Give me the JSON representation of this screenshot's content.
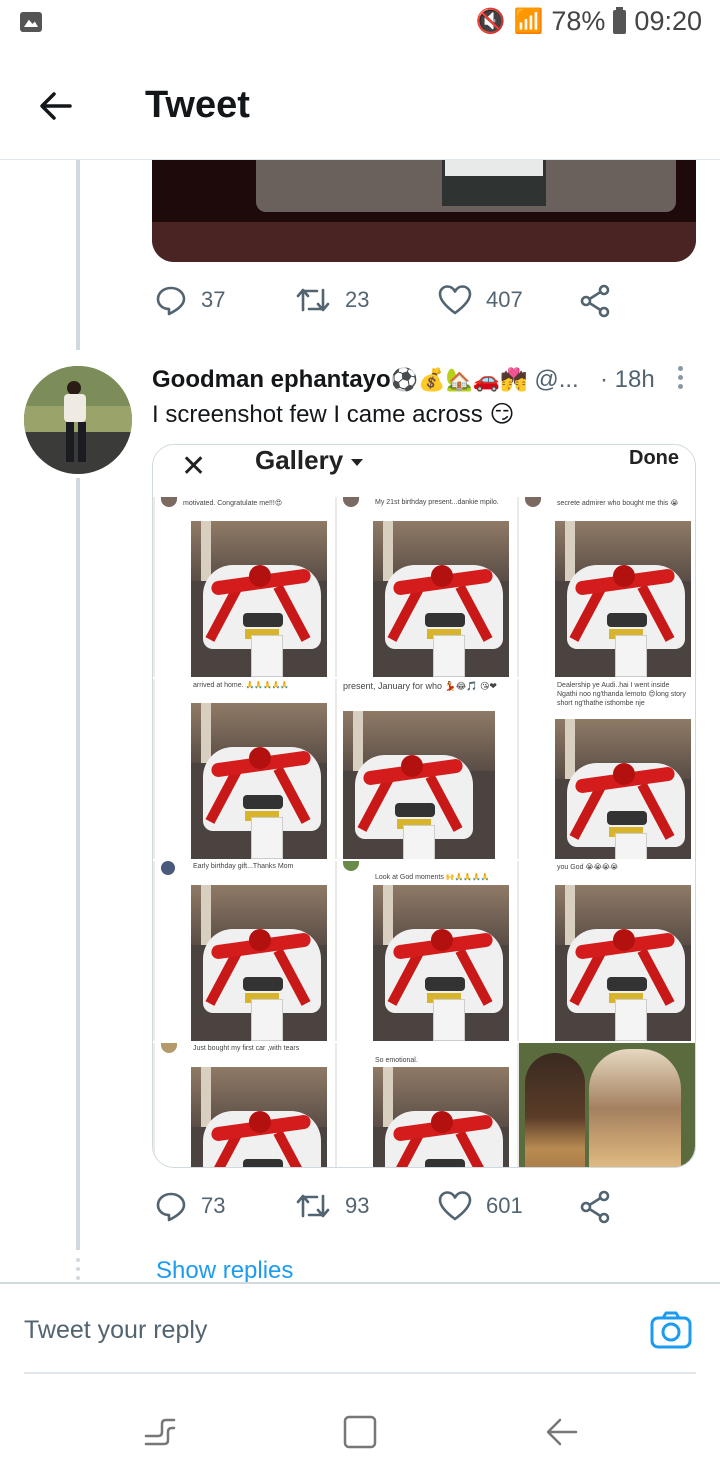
{
  "status_bar": {
    "battery_percent": "78%",
    "time": "09:20"
  },
  "header": {
    "title": "Tweet"
  },
  "previous_tweet": {
    "reply_count": "37",
    "retweet_count": "23",
    "like_count": "407"
  },
  "tweet": {
    "author_name": "Goodman ephantayo",
    "author_emoji": "⚽💰🏡🚗💏",
    "author_handle": "@...",
    "time": "· 18h",
    "text": "I screenshot few I came across 😏",
    "media": {
      "gallery_close": "✕",
      "gallery_title": "Gallery",
      "gallery_done": "Done",
      "captions": [
        "motivated. Congratulate me!!!😍",
        "My 21st birthday present...dankie mpilo.",
        "secrete admirer who bought me this 😭",
        "arrived at home. 🙏🙏🙏🙏🙏",
        "present, January for who 💃😂🎵 😘❤",
        "Dealership ye Audi..hai I went inside Ngathi noo ng'thanda lemoto 😍long story short ng'thathe isthombe nje",
        "Early birthday gift...Thanks Mom",
        "Look at God moments 🙌🙏🙏🙏🙏",
        "you God 😭😭😭😭",
        "Just bought my first car ,with tears",
        "So emotional."
      ]
    },
    "reply_count": "73",
    "retweet_count": "93",
    "like_count": "601"
  },
  "show_replies": "Show replies",
  "reply_bar": {
    "placeholder": "Tweet your reply"
  },
  "colors": {
    "accent": "#1d9bf0",
    "secondary_text": "#536471",
    "border": "#cfd9de"
  }
}
